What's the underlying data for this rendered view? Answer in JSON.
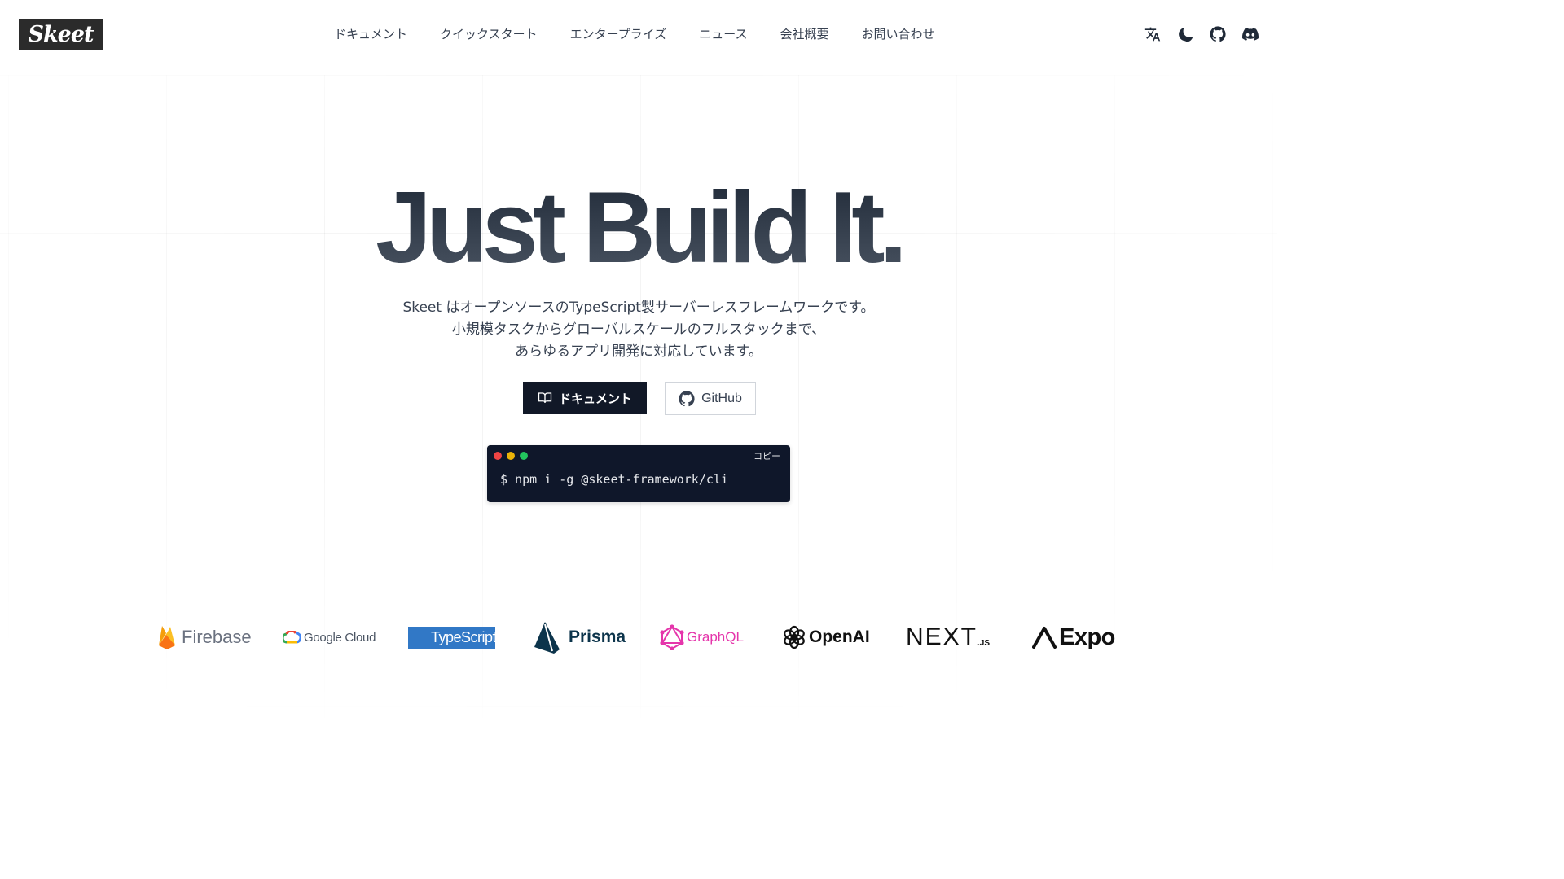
{
  "header": {
    "logo_text": "Skeet",
    "nav": [
      {
        "label": "ドキュメント"
      },
      {
        "label": "クイックスタート"
      },
      {
        "label": "エンタープライズ"
      },
      {
        "label": "ニュース"
      },
      {
        "label": "会社概要"
      },
      {
        "label": "お問い合わせ"
      }
    ],
    "icons": [
      "language-icon",
      "moon-icon",
      "github-icon",
      "discord-icon"
    ]
  },
  "hero": {
    "title": "Just Build It.",
    "description": [
      "Skeet はオープンソースのTypeScript製サーバーレスフレームワークです。",
      "小規模タスクからグローバルスケールのフルスタックまで、",
      "あらゆるアプリ開発に対応しています。"
    ],
    "docs_button": "ドキュメント",
    "github_button": "GitHub"
  },
  "terminal": {
    "copy_label": "コピー",
    "command": "$ npm i -g @skeet-framework/cli",
    "dot_colors": [
      "#ef4444",
      "#eab308",
      "#22c55e"
    ]
  },
  "logos": {
    "firebase": "Firebase",
    "google_cloud": "Google Cloud",
    "typescript": "TypeScript",
    "prisma": "Prisma",
    "graphql": "GraphQL",
    "openai": "OpenAI",
    "nextjs": "NEXT",
    "nextjs_suffix": ".JS",
    "expo": "Expo"
  },
  "colors": {
    "dark": "#111827",
    "graphql": "#e535ab",
    "typescript": "#3178c6",
    "prisma": "#0c344b"
  }
}
